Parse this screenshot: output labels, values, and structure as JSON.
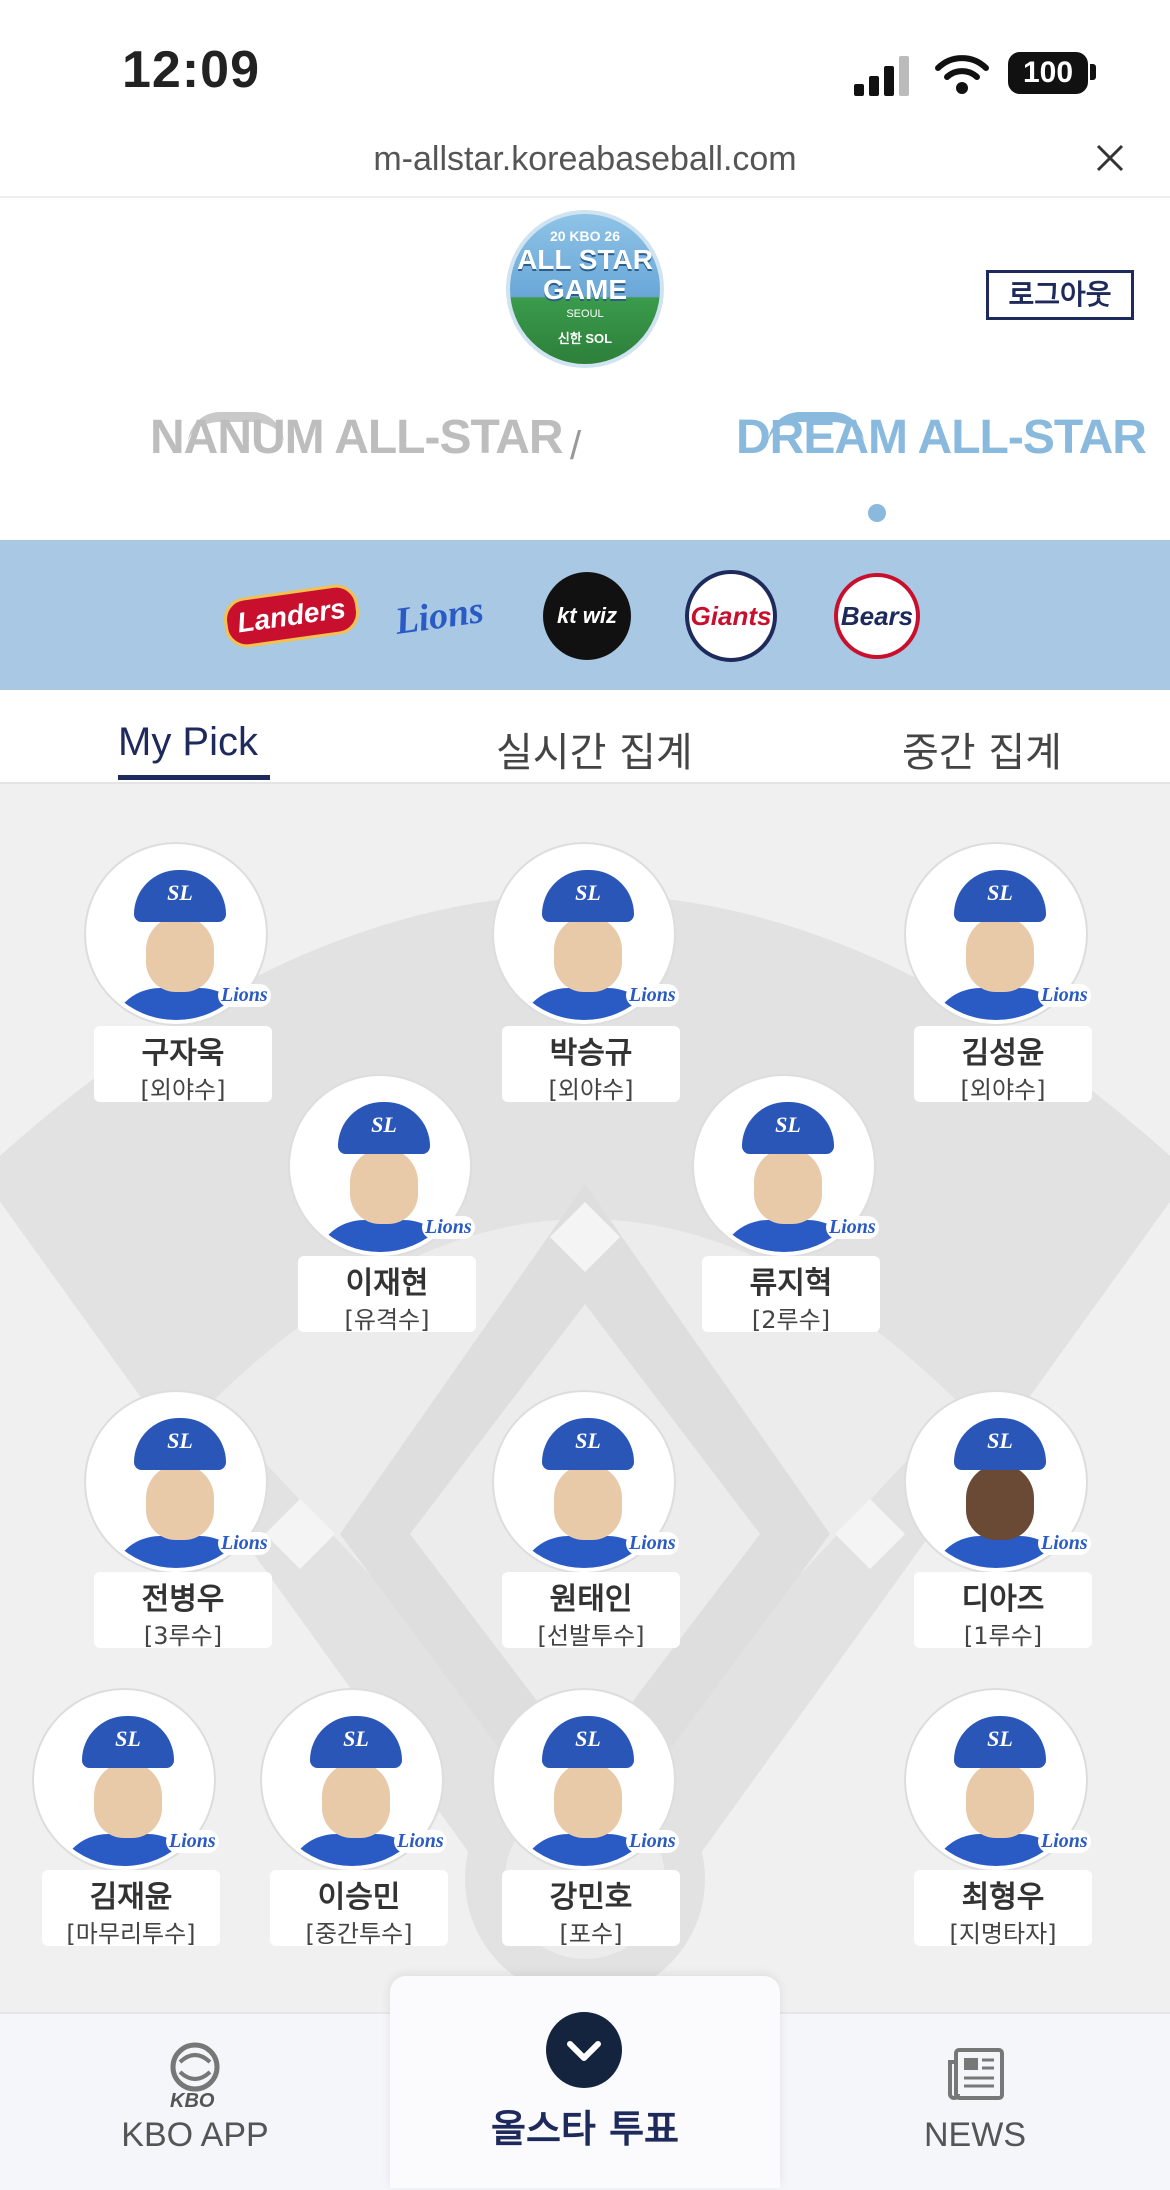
{
  "status_bar": {
    "time": "12:09",
    "battery": "100"
  },
  "browser": {
    "url": "m-allstar.koreabaseball.com"
  },
  "header": {
    "logo": {
      "line1": "20 KBO 26",
      "line2": "ALL STAR",
      "line3": "GAME",
      "line4": "SEOUL",
      "sponsor": "신한 SOL"
    },
    "logout_label": "로그아웃",
    "nanum_label": "NANUM ALL-STAR",
    "separator": "/",
    "dream_label": "DREAM ALL-STAR"
  },
  "teams": [
    {
      "name": "Landers",
      "color": "#c8102e"
    },
    {
      "name": "Lions",
      "color": "#2a5bc4"
    },
    {
      "name": "kt wiz",
      "color": "#111111"
    },
    {
      "name": "Giants",
      "color": "#c8102e"
    },
    {
      "name": "Bears",
      "color": "#1d2a5b"
    }
  ],
  "tabs": [
    {
      "label": "My Pick",
      "active": true
    },
    {
      "label": "실시간 집계",
      "active": false
    },
    {
      "label": "중간 집계",
      "active": false
    }
  ],
  "players": [
    {
      "name": "구자욱",
      "position": "[외야수]",
      "team": "Lions"
    },
    {
      "name": "박승규",
      "position": "[외야수]",
      "team": "Lions"
    },
    {
      "name": "김성윤",
      "position": "[외야수]",
      "team": "Lions"
    },
    {
      "name": "이재현",
      "position": "[유격수]",
      "team": "Lions"
    },
    {
      "name": "류지혁",
      "position": "[2루수]",
      "team": "Lions"
    },
    {
      "name": "전병우",
      "position": "[3루수]",
      "team": "Lions"
    },
    {
      "name": "원태인",
      "position": "[선발투수]",
      "team": "Lions"
    },
    {
      "name": "디아즈",
      "position": "[1루수]",
      "team": "Lions"
    },
    {
      "name": "김재윤",
      "position": "[마무리투수]",
      "team": "Lions"
    },
    {
      "name": "이승민",
      "position": "[중간투수]",
      "team": "Lions"
    },
    {
      "name": "강민호",
      "position": "[포수]",
      "team": "Lions"
    },
    {
      "name": "최형우",
      "position": "[지명타자]",
      "team": "Lions"
    }
  ],
  "cap_logo": "SL",
  "bottom_nav": {
    "kbo_small": "KBO",
    "kbo_label": "KBO APP",
    "vote_label": "올스타 투표",
    "news_label": "NEWS"
  },
  "colors": {
    "navy": "#1d2a5b",
    "team_band": "#a9c8e3",
    "field": "#f0f0f0"
  }
}
